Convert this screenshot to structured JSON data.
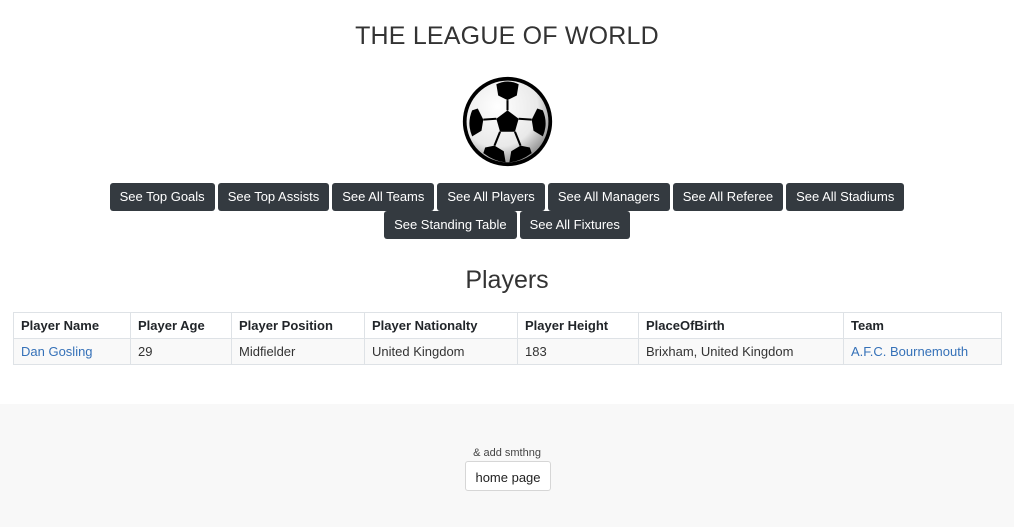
{
  "header": {
    "title": "THE LEAGUE OF WORLD",
    "logo_icon": "soccer-ball-icon"
  },
  "nav": {
    "buttons": [
      {
        "label": "See Top Goals"
      },
      {
        "label": "See Top Assists"
      },
      {
        "label": "See All Teams"
      },
      {
        "label": "See All Players"
      },
      {
        "label": "See All Managers"
      },
      {
        "label": "See All Referee"
      },
      {
        "label": "See All Stadiums"
      },
      {
        "label": "See Standing Table"
      },
      {
        "label": "See All Fixtures"
      }
    ],
    "button_color": "#343a40"
  },
  "main": {
    "heading": "Players",
    "table": {
      "columns": [
        "Player Name",
        "Player Age",
        "Player Position",
        "Player Nationalty",
        "Player Height",
        "PlaceOfBirth",
        "Team"
      ],
      "rows": [
        [
          "Dan Gosling",
          "29",
          "Midfielder",
          "United Kingdom",
          "183",
          "Brixham, United Kingdom",
          "A.F.C. Bournemouth"
        ]
      ]
    },
    "link_color": "#3571b8"
  },
  "footer": {
    "note": "& add smthng",
    "home_button": "home page"
  }
}
